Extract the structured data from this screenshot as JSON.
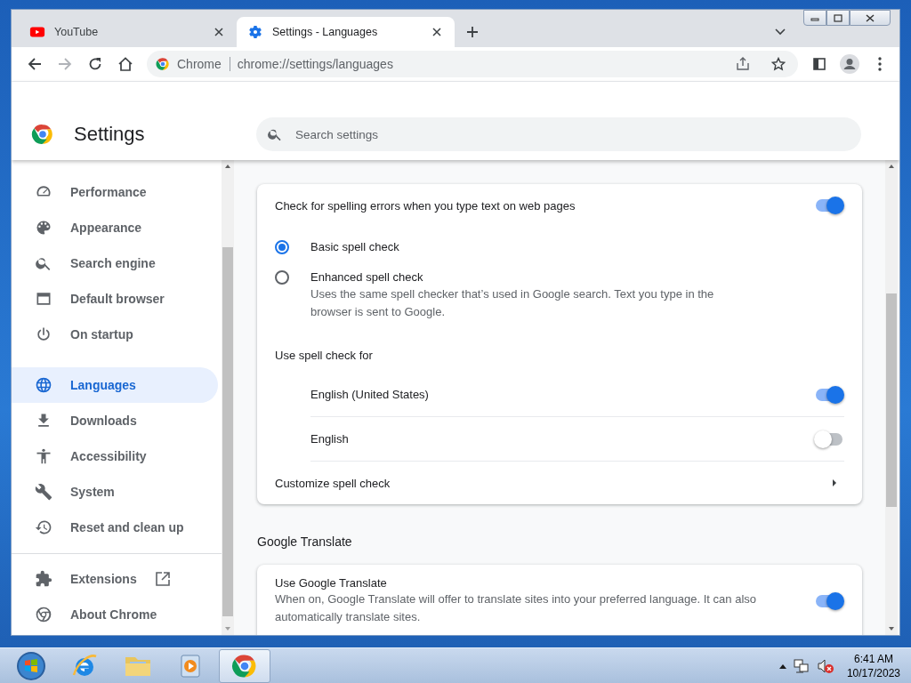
{
  "tabs": [
    {
      "title": "YouTube",
      "selected": false
    },
    {
      "title": "Settings - Languages",
      "selected": true
    }
  ],
  "omnibox": {
    "chip": "Chrome",
    "url": "chrome://settings/languages"
  },
  "header": {
    "title": "Settings",
    "search_placeholder": "Search settings"
  },
  "sidebar": {
    "groups": [
      [
        {
          "label": "Performance",
          "selected": false,
          "external": false
        },
        {
          "label": "Appearance",
          "selected": false,
          "external": false
        },
        {
          "label": "Search engine",
          "selected": false,
          "external": false
        },
        {
          "label": "Default browser",
          "selected": false,
          "external": false
        },
        {
          "label": "On startup",
          "selected": false,
          "external": false
        }
      ],
      [
        {
          "label": "Languages",
          "selected": true,
          "external": false
        },
        {
          "label": "Downloads",
          "selected": false,
          "external": false
        },
        {
          "label": "Accessibility",
          "selected": false,
          "external": false
        },
        {
          "label": "System",
          "selected": false,
          "external": false
        },
        {
          "label": "Reset and clean up",
          "selected": false,
          "external": false
        }
      ],
      [
        {
          "label": "Extensions",
          "selected": false,
          "external": true
        },
        {
          "label": "About Chrome",
          "selected": false,
          "external": false
        }
      ]
    ]
  },
  "spell_check": {
    "toggle": {
      "label": "Check for spelling errors when you type text on web pages",
      "on": true
    },
    "options": [
      {
        "label": "Basic spell check",
        "selected": true
      },
      {
        "label": "Enhanced spell check",
        "description": "Uses the same spell checker that’s used in Google search. Text you type in the browser is sent to Google.",
        "selected": false
      }
    ],
    "use_for_label": "Use spell check for",
    "languages": [
      {
        "name": "English (United States)",
        "on": true
      },
      {
        "name": "English",
        "on": false
      }
    ],
    "customize": "Customize spell check"
  },
  "google_translate": {
    "heading": "Google Translate",
    "toggle": {
      "label": "Use Google Translate",
      "description": "When on, Google Translate will offer to translate sites into your preferred language. It can also automatically translate sites.",
      "on": true
    }
  },
  "taskbar": {
    "apps": [
      {
        "active": false
      },
      {
        "active": false
      },
      {
        "active": false
      },
      {
        "active": true
      }
    ],
    "time": "6:41 AM",
    "date": "10/17/2023"
  }
}
